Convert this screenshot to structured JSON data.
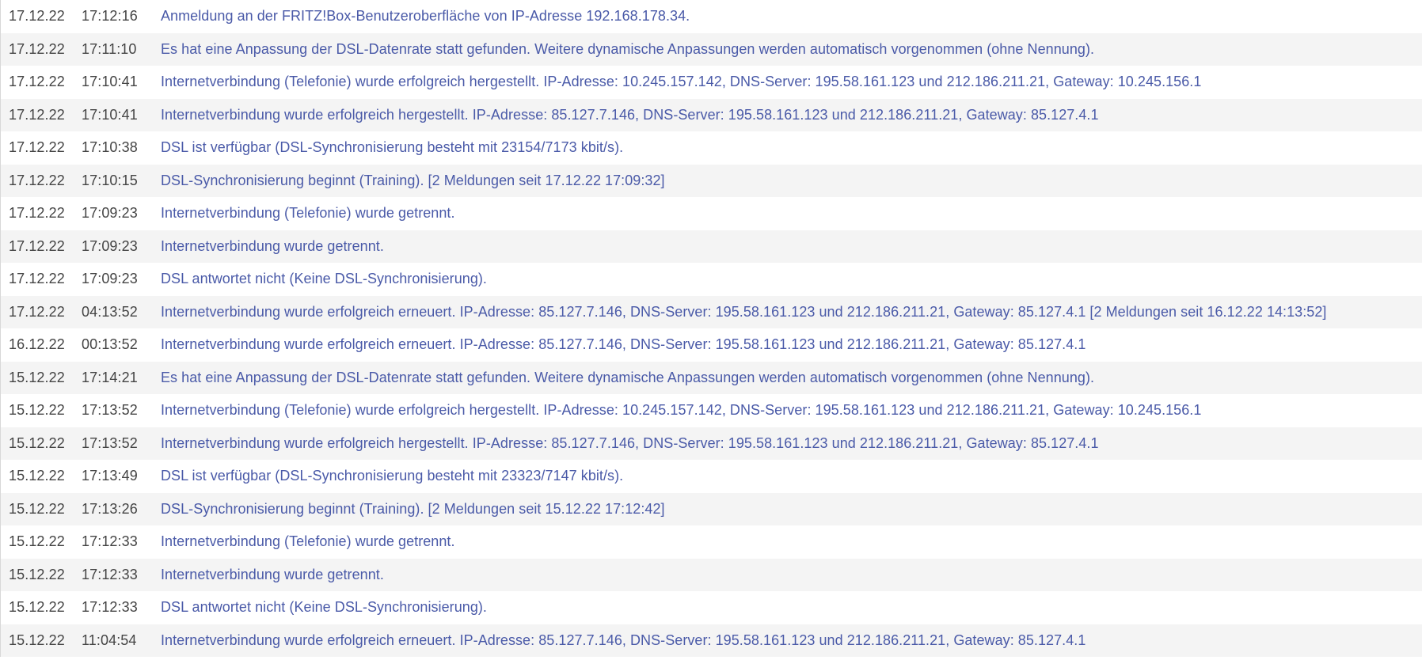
{
  "event_log": {
    "entries": [
      {
        "date": "17.12.22",
        "time": "17:12:16",
        "message": "Anmeldung an der FRITZ!Box-Benutzeroberfläche von IP-Adresse 192.168.178.34."
      },
      {
        "date": "17.12.22",
        "time": "17:11:10",
        "message": "Es hat eine Anpassung der DSL-Datenrate statt gefunden. Weitere dynamische Anpassungen werden automatisch vorgenommen (ohne Nennung)."
      },
      {
        "date": "17.12.22",
        "time": "17:10:41",
        "message": "Internetverbindung (Telefonie) wurde erfolgreich hergestellt. IP-Adresse: 10.245.157.142, DNS-Server: 195.58.161.123 und 212.186.211.21, Gateway: 10.245.156.1"
      },
      {
        "date": "17.12.22",
        "time": "17:10:41",
        "message": "Internetverbindung wurde erfolgreich hergestellt. IP-Adresse: 85.127.7.146, DNS-Server: 195.58.161.123 und 212.186.211.21, Gateway: 85.127.4.1"
      },
      {
        "date": "17.12.22",
        "time": "17:10:38",
        "message": "DSL ist verfügbar (DSL-Synchronisierung besteht mit 23154/7173 kbit/s)."
      },
      {
        "date": "17.12.22",
        "time": "17:10:15",
        "message": "DSL-Synchronisierung beginnt (Training). [2 Meldungen seit 17.12.22 17:09:32]"
      },
      {
        "date": "17.12.22",
        "time": "17:09:23",
        "message": "Internetverbindung (Telefonie) wurde getrennt."
      },
      {
        "date": "17.12.22",
        "time": "17:09:23",
        "message": "Internetverbindung wurde getrennt."
      },
      {
        "date": "17.12.22",
        "time": "17:09:23",
        "message": "DSL antwortet nicht (Keine DSL-Synchronisierung)."
      },
      {
        "date": "17.12.22",
        "time": "04:13:52",
        "message": "Internetverbindung wurde erfolgreich erneuert. IP-Adresse: 85.127.7.146, DNS-Server: 195.58.161.123 und 212.186.211.21, Gateway: 85.127.4.1 [2 Meldungen seit 16.12.22 14:13:52]"
      },
      {
        "date": "16.12.22",
        "time": "00:13:52",
        "message": "Internetverbindung wurde erfolgreich erneuert. IP-Adresse: 85.127.7.146, DNS-Server: 195.58.161.123 und 212.186.211.21, Gateway: 85.127.4.1"
      },
      {
        "date": "15.12.22",
        "time": "17:14:21",
        "message": "Es hat eine Anpassung der DSL-Datenrate statt gefunden. Weitere dynamische Anpassungen werden automatisch vorgenommen (ohne Nennung)."
      },
      {
        "date": "15.12.22",
        "time": "17:13:52",
        "message": "Internetverbindung (Telefonie) wurde erfolgreich hergestellt. IP-Adresse: 10.245.157.142, DNS-Server: 195.58.161.123 und 212.186.211.21, Gateway: 10.245.156.1"
      },
      {
        "date": "15.12.22",
        "time": "17:13:52",
        "message": "Internetverbindung wurde erfolgreich hergestellt. IP-Adresse: 85.127.7.146, DNS-Server: 195.58.161.123 und 212.186.211.21, Gateway: 85.127.4.1"
      },
      {
        "date": "15.12.22",
        "time": "17:13:49",
        "message": "DSL ist verfügbar (DSL-Synchronisierung besteht mit 23323/7147 kbit/s)."
      },
      {
        "date": "15.12.22",
        "time": "17:13:26",
        "message": "DSL-Synchronisierung beginnt (Training). [2 Meldungen seit 15.12.22 17:12:42]"
      },
      {
        "date": "15.12.22",
        "time": "17:12:33",
        "message": "Internetverbindung (Telefonie) wurde getrennt."
      },
      {
        "date": "15.12.22",
        "time": "17:12:33",
        "message": "Internetverbindung wurde getrennt."
      },
      {
        "date": "15.12.22",
        "time": "17:12:33",
        "message": "DSL antwortet nicht (Keine DSL-Synchronisierung)."
      },
      {
        "date": "15.12.22",
        "time": "11:04:54",
        "message": "Internetverbindung wurde erfolgreich erneuert. IP-Adresse: 85.127.7.146, DNS-Server: 195.58.161.123 und 212.186.211.21, Gateway: 85.127.4.1"
      }
    ]
  },
  "colors": {
    "message_link": "#4a5aa8",
    "row_alt_background": "#f4f4f4",
    "row_background": "#ffffff",
    "date_time_text": "#444444"
  }
}
